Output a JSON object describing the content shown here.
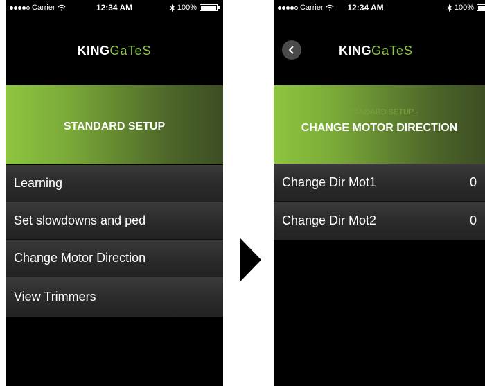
{
  "left_screen": {
    "status": {
      "carrier": "Carrier",
      "time": "12:34 AM",
      "battery": "100%"
    },
    "brand": {
      "king": "KING",
      "gates": "GaTeS"
    },
    "banner_title": "STANDARD SETUP",
    "menu_items": [
      {
        "label": "Learning"
      },
      {
        "label": "Set slowdowns and ped"
      },
      {
        "label": "Change Motor Direction"
      },
      {
        "label": "View Trimmers"
      }
    ]
  },
  "right_screen": {
    "status": {
      "carrier": "Carrier",
      "time": "12:34 AM",
      "battery": "100%"
    },
    "brand": {
      "king": "KING",
      "gates": "GaTeS"
    },
    "banner_subtitle": "- STANDARD SETUP -",
    "banner_title": "CHANGE MOTOR DIRECTION",
    "back_icon": "chevron-left-icon",
    "rows": [
      {
        "label": "Change Dir Mot1",
        "value": "0"
      },
      {
        "label": "Change Dir Mot2",
        "value": "0"
      }
    ]
  },
  "transition_icon": "arrow-right-icon",
  "colors": {
    "accent": "#8cc63f",
    "background": "#000000"
  }
}
